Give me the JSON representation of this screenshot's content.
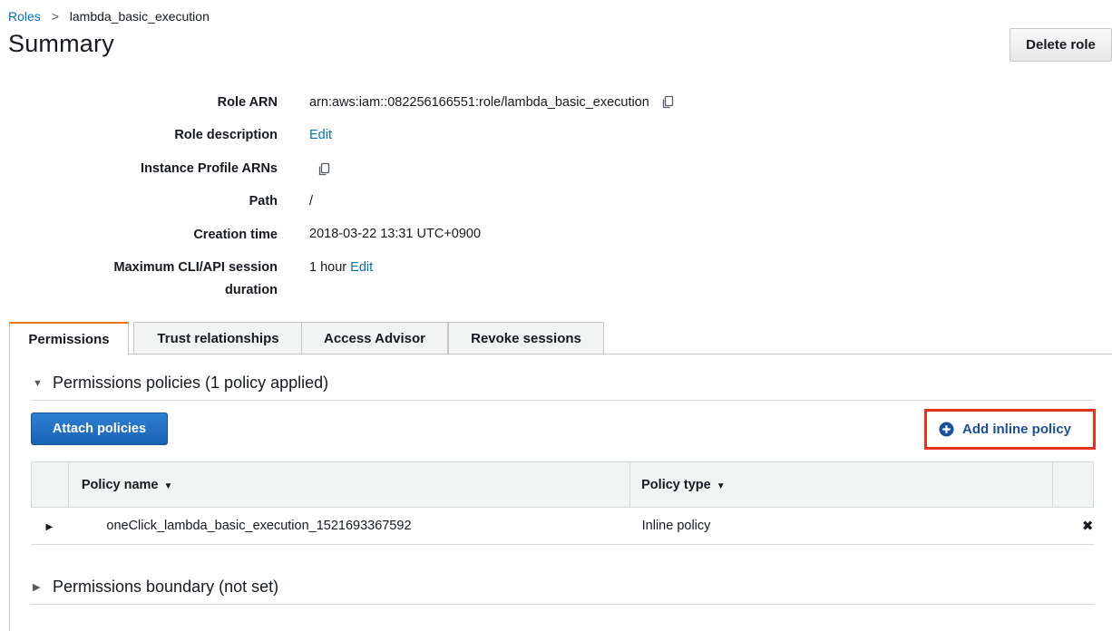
{
  "breadcrumb": {
    "parent": "Roles",
    "separator": ">",
    "current": "lambda_basic_execution"
  },
  "page": {
    "title": "Summary"
  },
  "header": {
    "delete_label": "Delete role"
  },
  "summary": {
    "role_arn_label": "Role ARN",
    "role_arn_value": "arn:aws:iam::082256166551:role/lambda_basic_execution",
    "role_description_label": "Role description",
    "role_description_edit": "Edit",
    "instance_profile_label": "Instance Profile ARNs",
    "path_label": "Path",
    "path_value": "/",
    "creation_time_label": "Creation time",
    "creation_time_value": "2018-03-22 13:31 UTC+0900",
    "max_session_label_line1": "Maximum CLI/API session",
    "max_session_label_line2": "duration",
    "max_session_value": "1 hour",
    "max_session_edit": "Edit"
  },
  "tabs": [
    {
      "label": "Permissions",
      "active": true
    },
    {
      "label": "Trust relationships",
      "active": false
    },
    {
      "label": "Access Advisor",
      "active": false
    },
    {
      "label": "Revoke sessions",
      "active": false
    }
  ],
  "permissions": {
    "policies_header": "Permissions policies (1 policy applied)",
    "attach_label": "Attach policies",
    "add_inline_label": "Add inline policy",
    "columns": {
      "policy_name": "Policy name",
      "policy_type": "Policy type"
    },
    "rows": [
      {
        "name": "oneClick_lambda_basic_execution_1521693367592",
        "type": "Inline policy"
      }
    ],
    "boundary_header": "Permissions boundary (not set)"
  },
  "icons": {
    "copy": "copy-icon",
    "plus": "plus-circle-icon",
    "remove": "x-icon",
    "expand": "caret-right-icon",
    "collapse": "caret-down-icon",
    "sort": "sort-caret-icon"
  },
  "colors": {
    "link": "#0073bb",
    "primary": "#1a63b5",
    "highlight": "#e8331c",
    "active_tab": "#ec7211"
  }
}
